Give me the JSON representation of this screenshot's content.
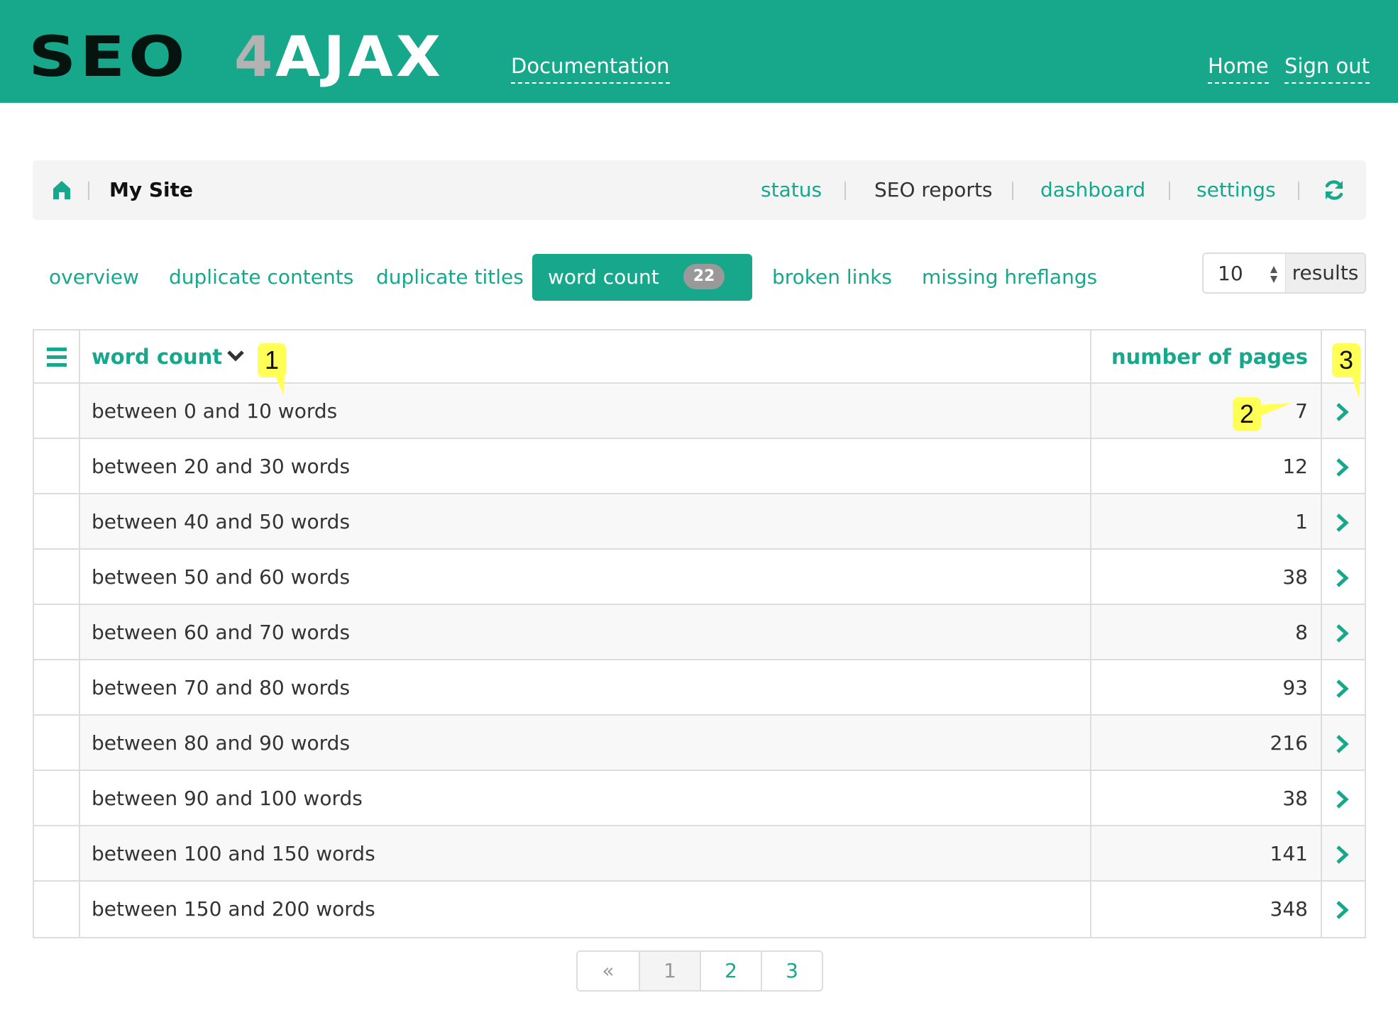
{
  "navbar": {
    "logo": {
      "part1": "SEO",
      "part2": "4",
      "part3": "AJAX"
    },
    "documentation_label": "Documentation",
    "home_label": "Home",
    "signout_label": "Sign out",
    "brand_color": "#17a88c"
  },
  "breadcrumb": {
    "home_icon": "home-icon",
    "site_name": "My Site",
    "links": [
      {
        "label": "status",
        "active": false
      },
      {
        "label": "SEO reports",
        "active": true
      },
      {
        "label": "dashboard",
        "active": false
      },
      {
        "label": "settings",
        "active": false
      }
    ],
    "refresh_icon": "refresh-icon"
  },
  "tabs": [
    {
      "label": "overview",
      "active": false
    },
    {
      "label": "duplicate contents",
      "active": false
    },
    {
      "label": "duplicate titles",
      "active": false
    },
    {
      "label": "word count",
      "active": true,
      "badge": "22"
    },
    {
      "label": "broken links",
      "active": false
    },
    {
      "label": "missing hreflangs",
      "active": false
    }
  ],
  "results": {
    "selected": "10",
    "addon_label": "results"
  },
  "table": {
    "columns": {
      "label": "word count",
      "number": "number of pages"
    },
    "sort_icon": "chevron-down-icon",
    "rows": [
      {
        "label": "between 0 and 10 words",
        "pages": "7"
      },
      {
        "label": "between 20 and 30 words",
        "pages": "12"
      },
      {
        "label": "between 40 and 50 words",
        "pages": "1"
      },
      {
        "label": "between 50 and 60 words",
        "pages": "38"
      },
      {
        "label": "between 60 and 70 words",
        "pages": "8"
      },
      {
        "label": "between 70 and 80 words",
        "pages": "93"
      },
      {
        "label": "between 80 and 90 words",
        "pages": "216"
      },
      {
        "label": "between 90 and 100 words",
        "pages": "38"
      },
      {
        "label": "between 100 and 150 words",
        "pages": "141"
      },
      {
        "label": "between 150 and 200 words",
        "pages": "348"
      }
    ]
  },
  "callouts": [
    "1",
    "2",
    "3"
  ],
  "pagination": {
    "prev_label": "«",
    "pages": [
      "1",
      "2",
      "3"
    ],
    "current": "1"
  }
}
